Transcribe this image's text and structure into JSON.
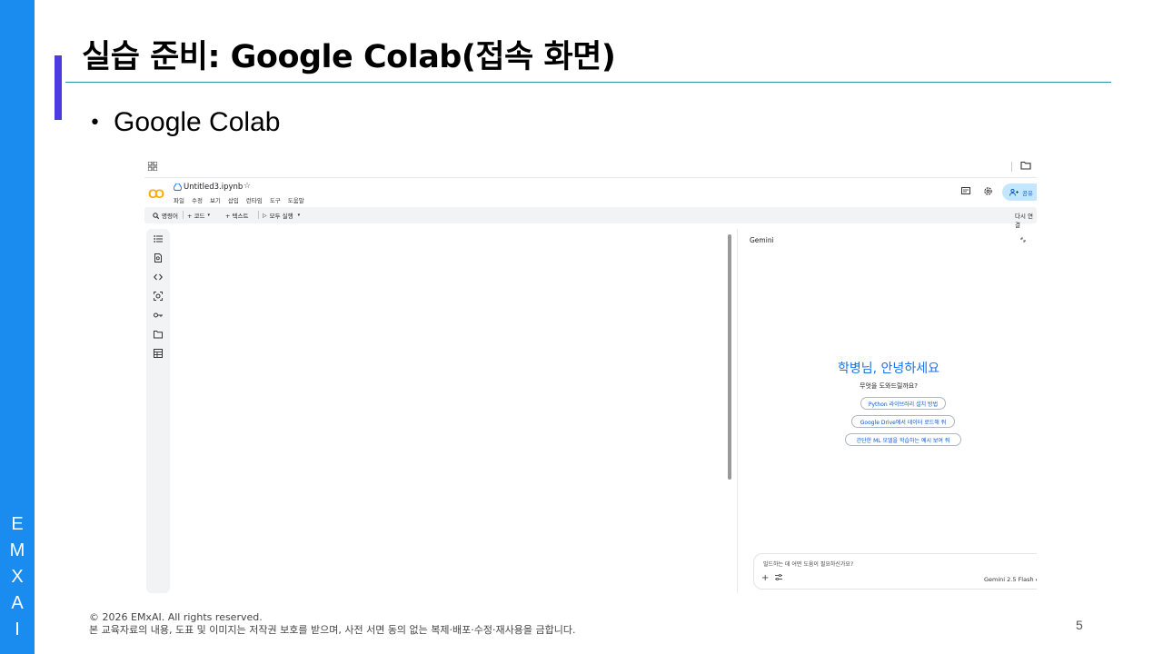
{
  "slide": {
    "title": "실습 준비: Google Colab(접속 화면)",
    "bullet": "Google Colab",
    "side_letters": [
      "E",
      "M",
      "X",
      "A",
      "I"
    ],
    "footer_line1": "© 2026 EMxAI. All rights reserved.",
    "footer_line2": "본 교육자료의 내용, 도표 및 이미지는 저작권 보호를 받으며, 사전 서면 동의 없는 복제·배포·수정·재사용을 금합니다.",
    "page_number": "5",
    "colors": {
      "side_bar": "#1a8cf0",
      "accent_bar": "#4b3be0",
      "title_rule": "#2a8fa0"
    }
  },
  "colab": {
    "notebook_name": "Untitled3.ipynb",
    "logo": "CO",
    "menu": [
      "파일",
      "수정",
      "보기",
      "삽입",
      "런타임",
      "도구",
      "도움말"
    ],
    "share_label": "공유",
    "toolbar": {
      "commands_label": "명령어",
      "add_code_label": "+ 코드",
      "add_text_label": "+ 텍스트",
      "run_all_label": "모두 실행",
      "reconnect_label": "다시 연결"
    },
    "rail_icons": [
      "toc-icon",
      "find-icon",
      "code-snippets-icon",
      "variables-icon",
      "secrets-icon",
      "files-icon",
      "data-table-icon"
    ],
    "gemini": {
      "title": "Gemini",
      "greeting": "학병님, 안녕하세요",
      "subtitle": "무엇을 도와드릴까요?",
      "suggestions": [
        "Python 라이브러리 설치 방법",
        "Google Drive에서 데이터 로드해 줘",
        "간단한 ML 모델을 학습하는 예시 보여 줘"
      ],
      "input_placeholder": "빌드하는 데 어떤 도움이 필요하신가요?",
      "model": "Gemini 2.5 Flash"
    }
  }
}
